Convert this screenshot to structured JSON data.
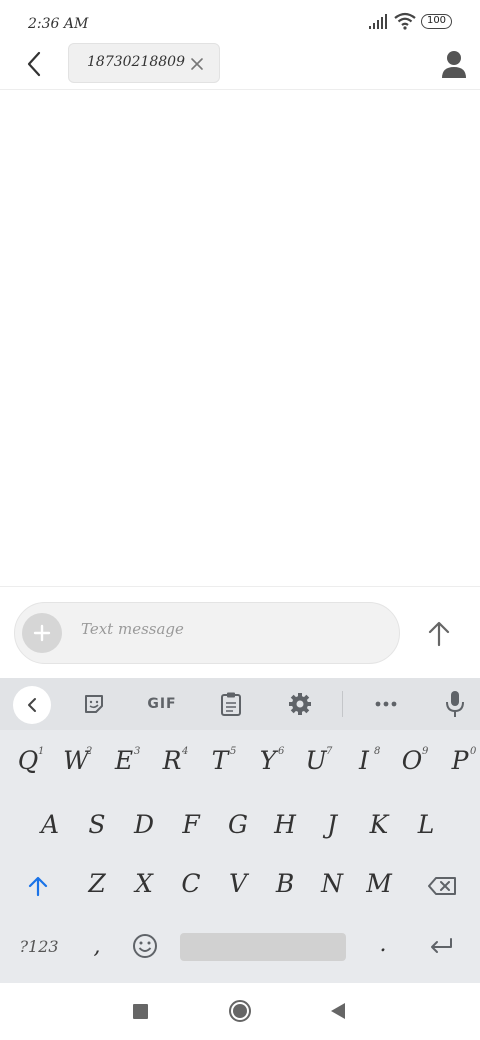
{
  "status_bar": {
    "time": "2:36 AM",
    "battery": "100"
  },
  "header": {
    "recipient": "18730218809"
  },
  "compose": {
    "placeholder": "Text message"
  },
  "keyboard": {
    "toolbar": {
      "gif_label": "GIF"
    },
    "row1": [
      {
        "letter": "Q",
        "hint": "1"
      },
      {
        "letter": "W",
        "hint": "2"
      },
      {
        "letter": "E",
        "hint": "3"
      },
      {
        "letter": "R",
        "hint": "4"
      },
      {
        "letter": "T",
        "hint": "5"
      },
      {
        "letter": "Y",
        "hint": "6"
      },
      {
        "letter": "U",
        "hint": "7"
      },
      {
        "letter": "I",
        "hint": "8"
      },
      {
        "letter": "O",
        "hint": "9"
      },
      {
        "letter": "P",
        "hint": "0"
      }
    ],
    "row2": [
      "A",
      "S",
      "D",
      "F",
      "G",
      "H",
      "J",
      "K",
      "L"
    ],
    "row3": [
      "Z",
      "X",
      "C",
      "V",
      "B",
      "N",
      "M"
    ],
    "bottom": {
      "symbols_label": "?123",
      "comma": ",",
      "period": "."
    }
  },
  "icons": {
    "back": "chevron-left-icon",
    "chip_remove": "close-icon",
    "contact": "person-icon",
    "attach": "plus-icon",
    "send": "arrow-up-icon",
    "sticker": "sticker-icon",
    "clipboard": "clipboard-icon",
    "settings": "gear-icon",
    "more": "more-icon",
    "mic": "mic-icon",
    "shift": "shift-icon",
    "delete": "backspace-icon",
    "emoji": "emoji-icon",
    "enter": "enter-icon"
  },
  "colors": {
    "shift_accent": "#1a73e8",
    "keyboard_bg": "#e8eaed"
  }
}
